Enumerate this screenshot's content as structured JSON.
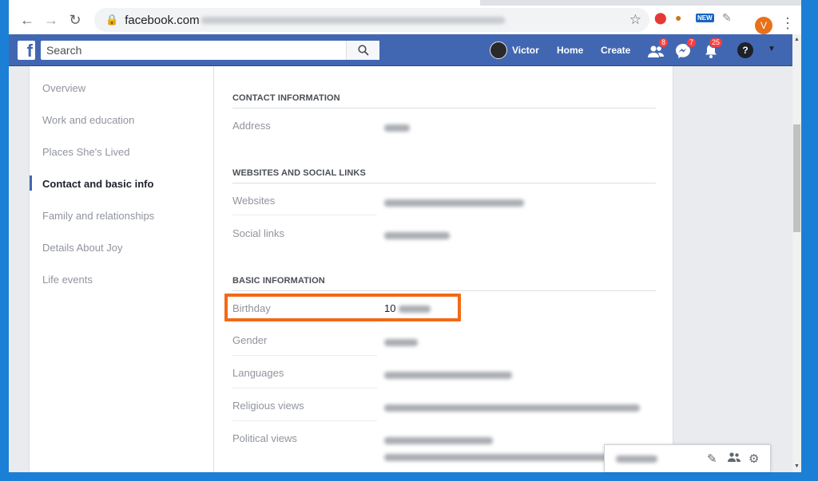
{
  "browser": {
    "host": "facebook.com",
    "new_badge": "NEW",
    "profile_initial": "V"
  },
  "fb": {
    "search_placeholder": "Search",
    "user_name": "Victor",
    "home": "Home",
    "create": "Create",
    "friend_requests_count": "8",
    "messages_count": "7",
    "notifications_count": "25",
    "help_glyph": "?"
  },
  "sidebar": {
    "items": [
      {
        "label": "Overview"
      },
      {
        "label": "Work and education"
      },
      {
        "label": "Places She's Lived"
      },
      {
        "label": "Contact and basic info"
      },
      {
        "label": "Family and relationships"
      },
      {
        "label": "Details About Joy"
      },
      {
        "label": "Life events"
      }
    ],
    "active_index": 3
  },
  "sections": {
    "contact": {
      "title": "CONTACT INFORMATION",
      "address_label": "Address"
    },
    "websites": {
      "title": "WEBSITES AND SOCIAL LINKS",
      "websites_label": "Websites",
      "social_label": "Social links"
    },
    "basic": {
      "title": "BASIC INFORMATION",
      "birthday_label": "Birthday",
      "birthday_value_visible": "10",
      "gender_label": "Gender",
      "languages_label": "Languages",
      "religious_label": "Religious views",
      "political_label": "Political views"
    }
  },
  "colors": {
    "fb_blue": "#4267b2",
    "highlight": "#f26a16",
    "desktop": "#1c7fd6"
  },
  "icons": [
    "back-icon",
    "forward-icon",
    "reload-icon",
    "lock-icon",
    "star-icon",
    "search-icon",
    "friends-icon",
    "messenger-icon",
    "bell-icon",
    "help-icon",
    "caret-down-icon",
    "compose-icon",
    "contacts-icon",
    "gear-icon"
  ]
}
